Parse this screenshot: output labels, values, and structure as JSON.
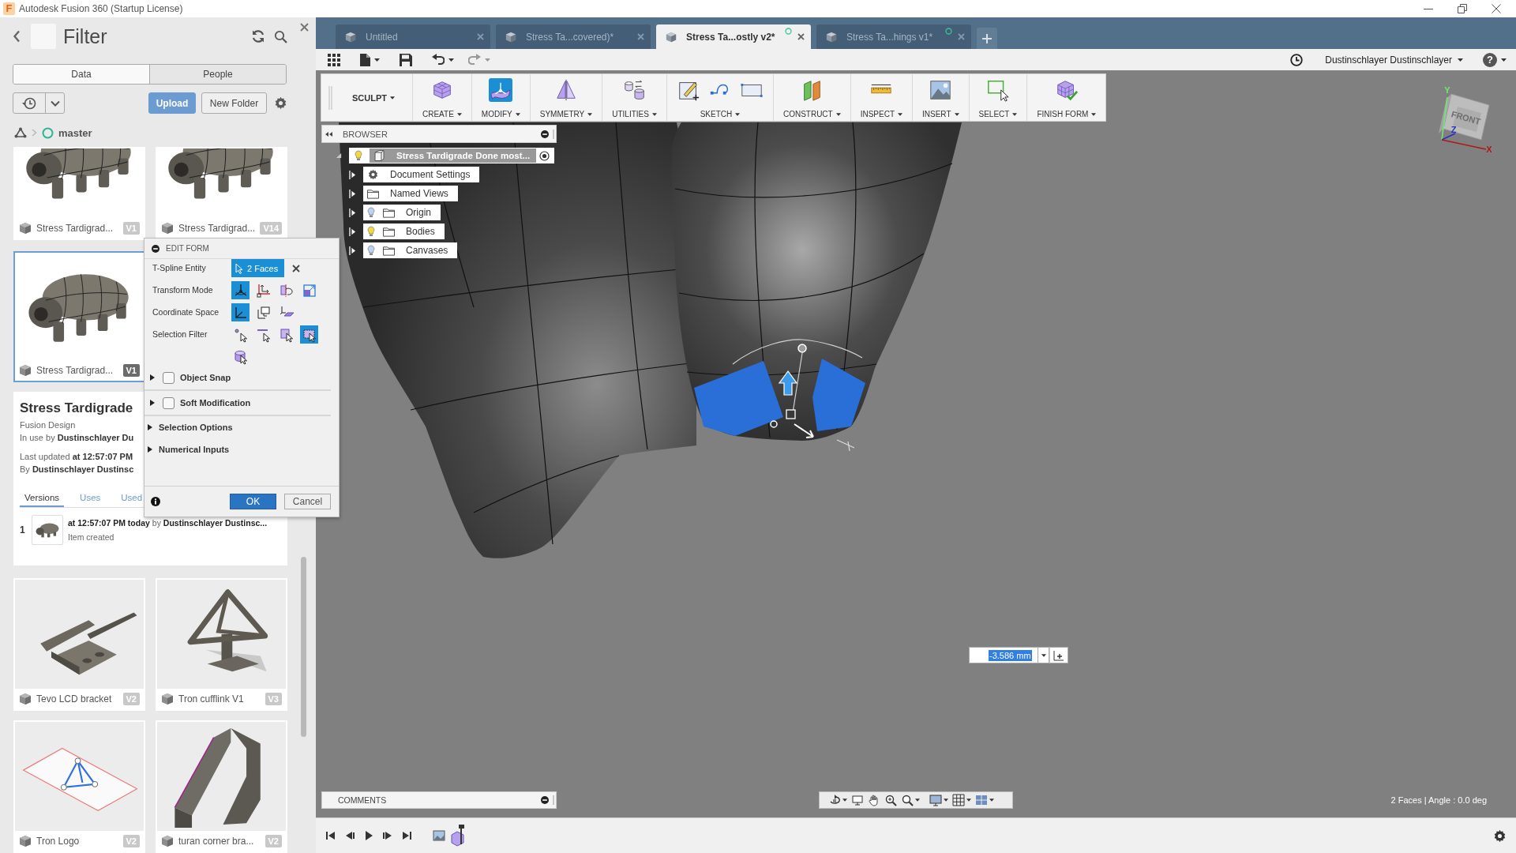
{
  "window": {
    "logo": "F",
    "title": "Autodesk Fusion 360 (Startup License)"
  },
  "data_panel": {
    "title": "Filter",
    "tabs": [
      {
        "label": "Data",
        "selected": true
      },
      {
        "label": "People",
        "selected": false
      }
    ],
    "actions": [
      {
        "label": "Upload",
        "kind": "primary"
      },
      {
        "label": "New Folder",
        "kind": "secondary"
      }
    ],
    "breadcrumb": "master",
    "files": [
      {
        "name": "Stress Tardigrad...",
        "version": "V1",
        "kind": "tardigrade",
        "selected": false
      },
      {
        "name": "Stress Tardigrad...",
        "version": "V14",
        "kind": "tardigrade",
        "selected": false
      },
      {
        "name": "Stress Tardigrad...",
        "version": "V1",
        "kind": "tardigrade",
        "selected": true
      },
      {
        "name": "Tevo LCD bracket",
        "version": "V2",
        "kind": "bracket",
        "selected": false
      },
      {
        "name": "Tron cufflink V1",
        "version": "V3",
        "kind": "cufflink",
        "selected": false
      },
      {
        "name": "Tron Logo",
        "version": "V2",
        "kind": "logo",
        "selected": false
      },
      {
        "name": "turan corner bra...",
        "version": "V2",
        "kind": "corner",
        "selected": false
      }
    ],
    "details": {
      "title": "Stress Tardigrade",
      "type": "Fusion Design",
      "lines": [
        "In use by **Dustinschlayer Du**",
        "Last updated **at 12:57:07 PM**",
        "By **Dustinschlayer Dustinsc**"
      ],
      "tabs": [
        {
          "label": "Versions",
          "selected": true
        },
        {
          "label": "Uses",
          "selected": false
        },
        {
          "label": "Used",
          "selected": false
        }
      ],
      "versions": [
        {
          "number": "1",
          "text": "**at 12:57:07 PM today** by **Dustinschlayer Dustinsc...**",
          "note": "Item created"
        }
      ]
    }
  },
  "edit_form": {
    "title": "EDIT FORM",
    "entity": {
      "label": "T-Spline Entity",
      "value": "2 Faces"
    },
    "option_rows": [
      {
        "label": "Transform Mode",
        "options": [
          {
            "kind": "multi",
            "selected": true
          },
          {
            "kind": "translate",
            "selected": false
          },
          {
            "kind": "rotate",
            "selected": false
          },
          {
            "kind": "scale",
            "selected": false
          }
        ]
      },
      {
        "label": "Coordinate Space",
        "options": [
          {
            "kind": "world",
            "selected": true
          },
          {
            "kind": "view",
            "selected": false
          },
          {
            "kind": "local",
            "selected": false
          }
        ]
      },
      {
        "label": "Selection Filter",
        "options": [
          {
            "kind": "vertex",
            "selected": false
          },
          {
            "kind": "edge",
            "selected": false
          },
          {
            "kind": "face",
            "selected": false
          },
          {
            "kind": "window",
            "selected": true
          },
          {
            "kind": "body",
            "selected": false
          }
        ]
      }
    ],
    "sections": [
      {
        "label": "Object Snap",
        "kind": "checkbox",
        "checked": false,
        "expanded": false
      },
      {
        "label": "Soft Modification",
        "kind": "checkbox",
        "checked": false,
        "expanded": false
      },
      {
        "label": "Selection Options",
        "kind": "group",
        "expanded": false
      },
      {
        "label": "Numerical Inputs",
        "kind": "group",
        "expanded": false
      }
    ],
    "buttons": [
      {
        "label": "OK",
        "kind": "primary"
      },
      {
        "label": "Cancel",
        "kind": "secondary"
      }
    ]
  },
  "document_tabs": [
    {
      "label": "Untitled",
      "selected": false,
      "sync_indicator": false
    },
    {
      "label": "Stress Ta...covered)*",
      "selected": false,
      "sync_indicator": false
    },
    {
      "label": "Stress Ta...ostly v2*",
      "selected": true,
      "sync_indicator": true
    },
    {
      "label": "Stress Ta...hings v1*",
      "selected": false,
      "sync_indicator": true
    }
  ],
  "user_menu": {
    "name": "Dustinschlayer Dustinschlayer"
  },
  "help": {
    "label": "?"
  },
  "toolbar": {
    "workspace": "SCULPT",
    "groups": [
      {
        "label": "CREATE",
        "kind": "create",
        "active": false
      },
      {
        "label": "MODIFY",
        "kind": "modify",
        "active": true
      },
      {
        "label": "SYMMETRY",
        "kind": "symmetry",
        "active": false
      },
      {
        "label": "UTILITIES",
        "kind": "utilities",
        "active": false
      },
      {
        "label": "SKETCH",
        "kind": "sketch",
        "active": false
      },
      {
        "label": "CONSTRUCT",
        "kind": "construct",
        "active": false
      },
      {
        "label": "INSPECT",
        "kind": "inspect",
        "active": false
      },
      {
        "label": "INSERT",
        "kind": "insert",
        "active": false
      },
      {
        "label": "SELECT",
        "kind": "select",
        "active": false
      },
      {
        "label": "FINISH FORM",
        "kind": "finish",
        "active": false
      }
    ]
  },
  "browser": {
    "title": "BROWSER",
    "root": {
      "label": "Stress Tardigrade Done most...",
      "expanded": true,
      "visible": true,
      "children": [
        {
          "label": "Document Settings",
          "kind": "settings",
          "expanded": false
        },
        {
          "label": "Named Views",
          "kind": "folder",
          "expanded": false
        },
        {
          "label": "Origin",
          "kind": "folder",
          "expanded": false,
          "visible": false
        },
        {
          "label": "Bodies",
          "kind": "folder",
          "expanded": false,
          "visible": true
        },
        {
          "label": "Canvases",
          "kind": "folder",
          "expanded": false,
          "visible": false
        }
      ]
    }
  },
  "viewport": {
    "viewcube": {
      "face": "FRONT",
      "axes": [
        {
          "label": "Y",
          "color": "#72e872"
        },
        {
          "label": "Z",
          "color": "#2333c8"
        },
        {
          "label": "X",
          "color": "#b01818"
        }
      ]
    },
    "dimension": {
      "value": "-3.586 mm"
    },
    "comments": {
      "title": "COMMENTS"
    },
    "status": "2 Faces | Angle : 0.0 deg"
  }
}
